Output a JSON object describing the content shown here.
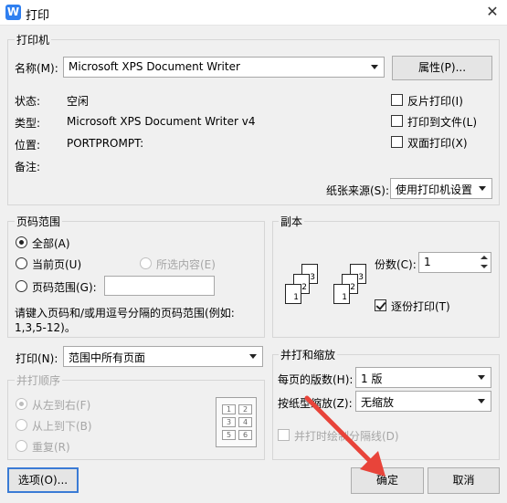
{
  "window": {
    "title": "打印",
    "icon": "W"
  },
  "printer": {
    "group": "打印机",
    "name_label": "名称(M):",
    "name_value": "Microsoft XPS Document Writer",
    "properties_button": "属性(P)...",
    "status_label": "状态:",
    "status_value": "空闲",
    "type_label": "类型:",
    "type_value": "Microsoft XPS Document Writer v4",
    "location_label": "位置:",
    "location_value": "PORTPROMPT:",
    "comment_label": "备注:",
    "reverse_print": "反片打印(I)",
    "print_to_file": "打印到文件(L)",
    "duplex": "双面打印(X)",
    "paper_source_label": "纸张来源(S):",
    "paper_source_value": "使用打印机设置"
  },
  "range": {
    "group": "页码范围",
    "all": "全部(A)",
    "current": "当前页(U)",
    "selection": "所选内容(E)",
    "pages": "页码范围(G):",
    "pages_value": "",
    "hint1": "请键入页码和/或用逗号分隔的页码范围(例如:",
    "hint2": "1,3,5-12)。"
  },
  "copies": {
    "group": "副本",
    "count_label": "份数(C):",
    "count_value": "1",
    "collate": "逐份打印(T)",
    "page_numbers": [
      "1",
      "2",
      "3"
    ]
  },
  "print_what": {
    "label": "打印(N):",
    "value": "范围中所有页面"
  },
  "order": {
    "group": "并打顺序",
    "ltr": "从左到右(F)",
    "ttb": "从上到下(B)",
    "repeat": "重复(R)",
    "grid": [
      "1",
      "2",
      "3",
      "4",
      "5",
      "6"
    ]
  },
  "zoom": {
    "group": "并打和缩放",
    "pages_per_sheet_label": "每页的版数(H):",
    "pages_per_sheet_value": "1 版",
    "scale_label": "按纸型缩放(Z):",
    "scale_value": "无缩放",
    "divider": "并打时绘制分隔线(D)"
  },
  "buttons": {
    "options": "选项(O)...",
    "ok": "确定",
    "cancel": "取消"
  },
  "colors": {
    "accent": "#3a7bd5",
    "annotation_arrow": "#e8443a"
  }
}
